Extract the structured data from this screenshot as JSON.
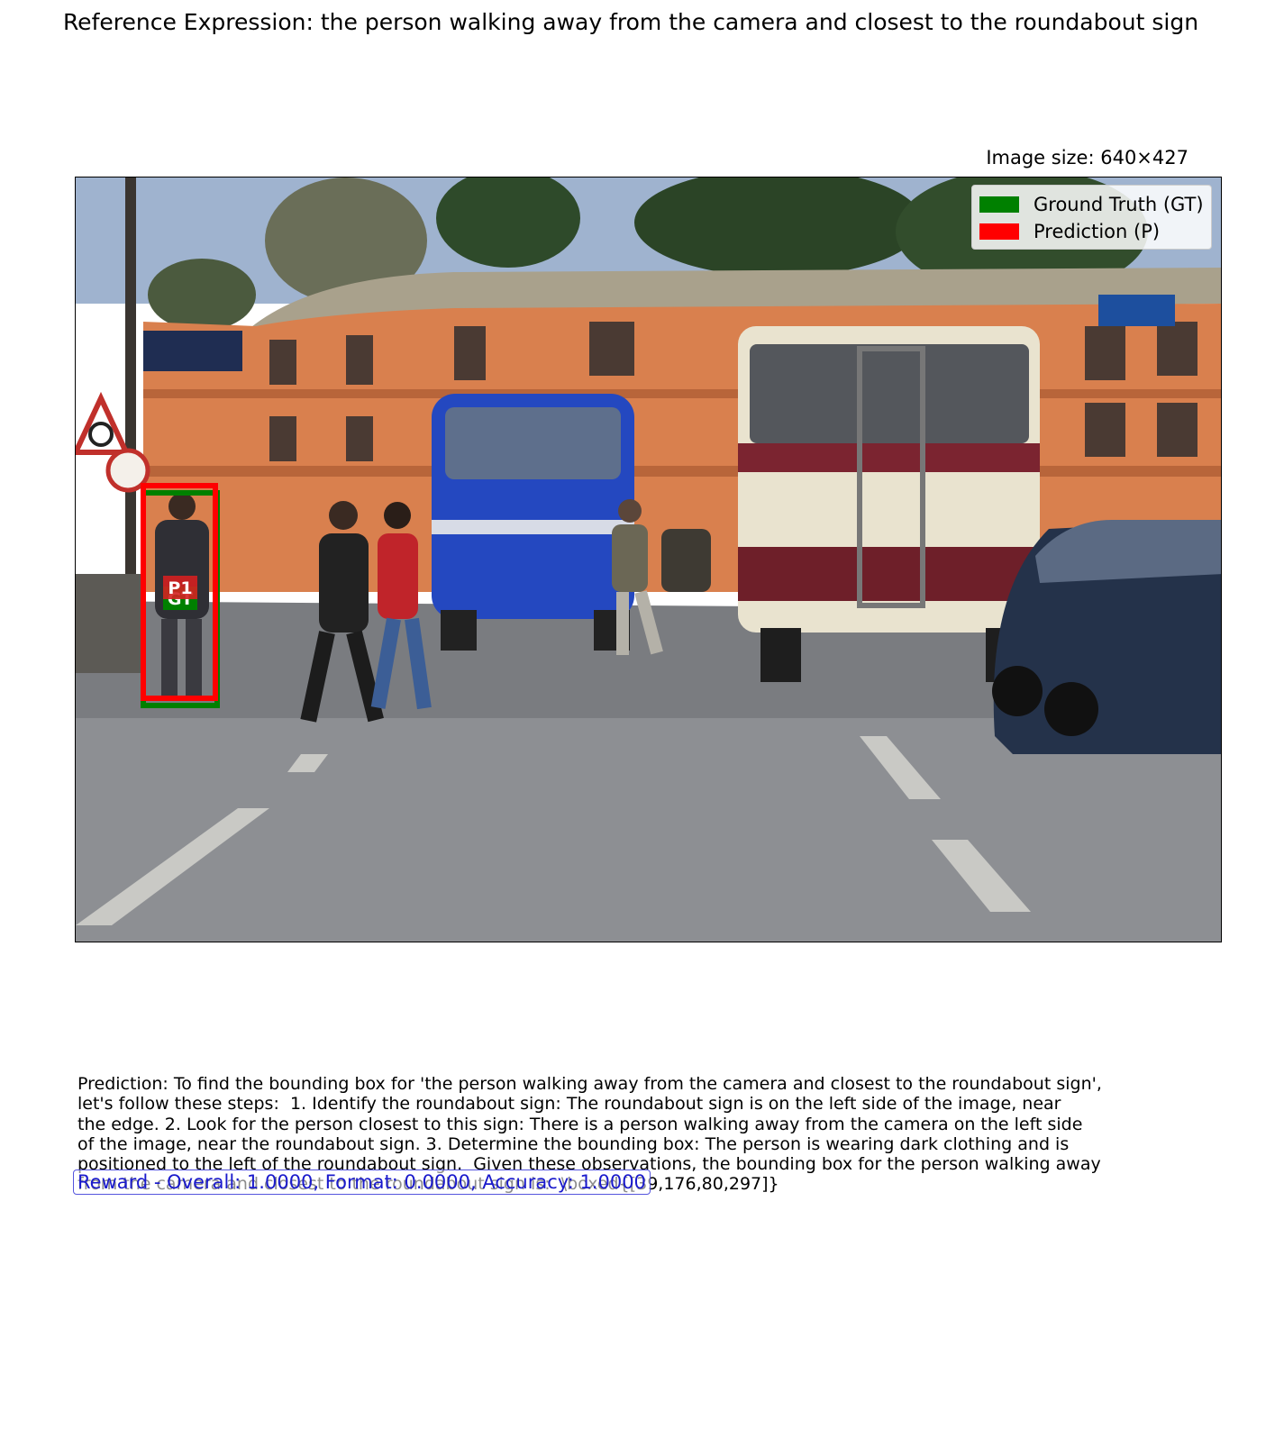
{
  "header": {
    "title": "Reference Expression: the person walking away from the camera and closest to the roundabout sign",
    "image_size": "Image size: 640×427"
  },
  "legend": {
    "gt_label": "Ground Truth (GT)",
    "pred_label": "Prediction (P)",
    "gt_color": "#008000",
    "pred_color": "#ff0000"
  },
  "boxes": {
    "gt_label": "GT",
    "pred_label": "P1"
  },
  "prediction": {
    "text": "Prediction: To find the bounding box for 'the person walking away from the camera and closest to the roundabout sign',\nlet's follow these steps:  1. Identify the roundabout sign: The roundabout sign is on the left side of the image, near\nthe edge. 2. Look for the person closest to this sign: There is a person walking away from the camera on the left side\nof the image, near the roundabout sign. 3. Determine the bounding box: The person is wearing dark clothing and is\npositioned to the left of the roundabout sign.  Given these observations, the bounding box for the person walking away\nfrom the camera and closest to the roundabout sign is:  \\boxed{[39,176,80,297]}"
  },
  "reward": {
    "text": "Reward - Overall: 1.0000, Format: 0.0000, Accuracy: 1.0000"
  }
}
